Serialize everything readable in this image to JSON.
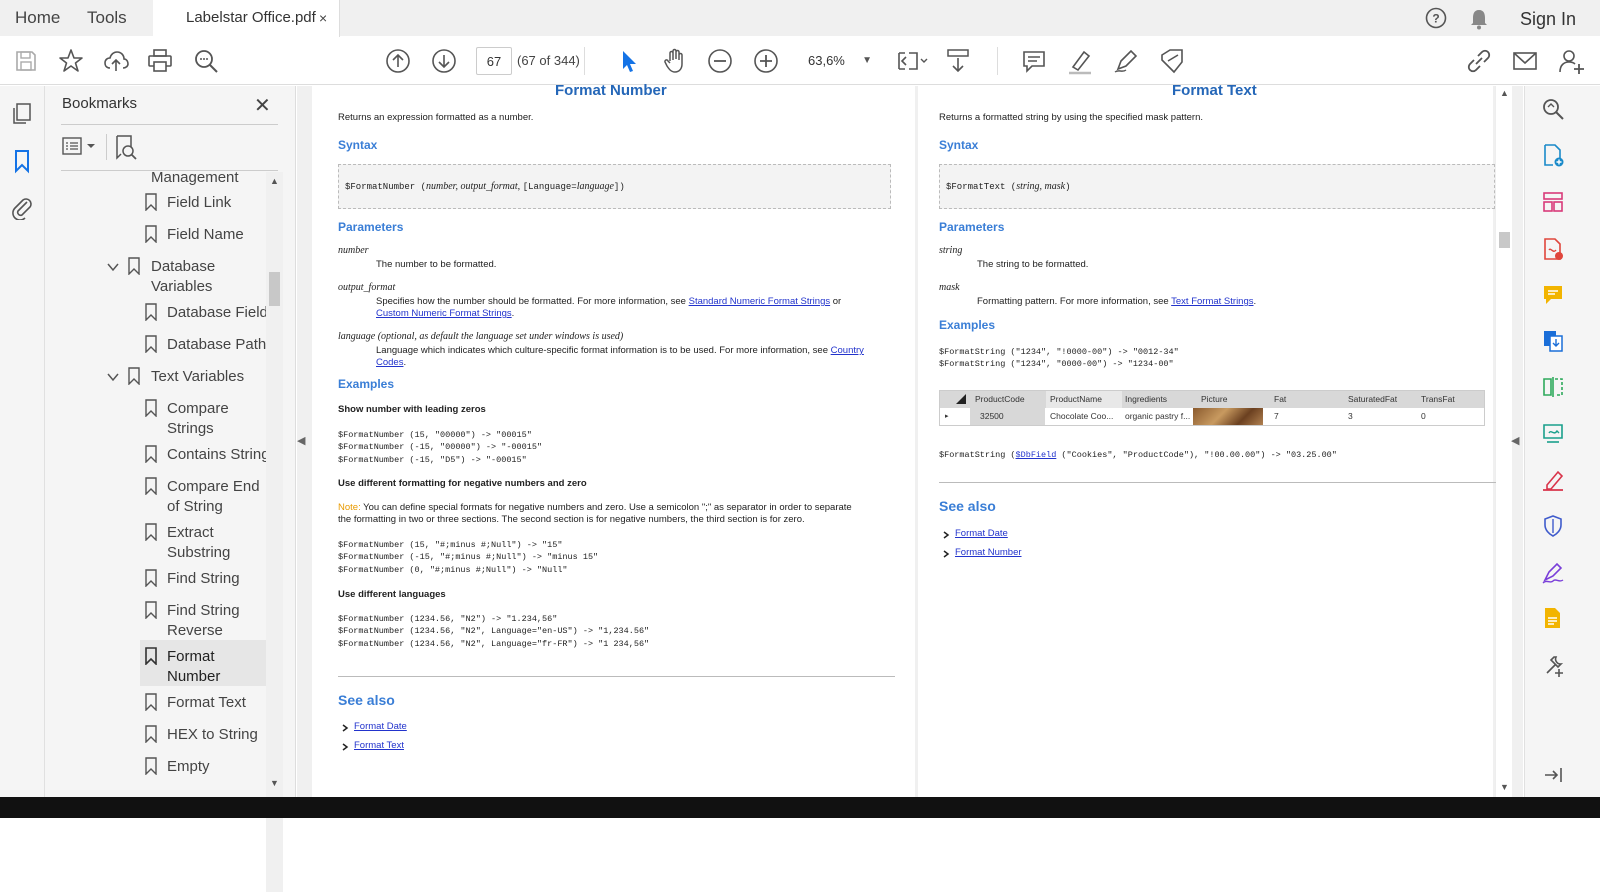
{
  "menubar": {
    "home": "Home",
    "tools": "Tools",
    "tab_title": "Labelstar Office.pdf",
    "tab_close": "×",
    "sign_in": "Sign In"
  },
  "toolbar": {
    "page_input": "67",
    "page_count": "(67 of 344)",
    "zoom": "63,6%"
  },
  "bookmarks": {
    "title": "Bookmarks",
    "close": "✕",
    "items": [
      {
        "label": "Management"
      },
      {
        "label": "Field Link"
      },
      {
        "label": "Field Name"
      },
      {
        "label": "Database"
      },
      {
        "label": "Variables"
      },
      {
        "label": "Database Field"
      },
      {
        "label": "Database Path"
      },
      {
        "label": "Text Variables"
      },
      {
        "label": "Compare"
      },
      {
        "label": "Strings"
      },
      {
        "label": "Contains String"
      },
      {
        "label": "Compare End"
      },
      {
        "label": "of String"
      },
      {
        "label": "Extract"
      },
      {
        "label": "Substring"
      },
      {
        "label": "Find String"
      },
      {
        "label": "Find String"
      },
      {
        "label": "Reverse"
      },
      {
        "label": "Format"
      },
      {
        "label": "Number"
      },
      {
        "label": "Format Text"
      },
      {
        "label": "HEX to String"
      },
      {
        "label": "Empty"
      }
    ]
  },
  "left_page": {
    "title": "Format Number",
    "desc": "Returns an expression formatted as a number.",
    "syntax_h": "Syntax",
    "syntax_code": "$FormatNumber (",
    "syntax_args": "number, output_format, ",
    "syntax_lang": "[Language=",
    "syntax_lang_arg": "language",
    "syntax_end": "])",
    "params_h": "Parameters",
    "p1_name": "number",
    "p1_desc": "The number to be formatted.",
    "p2_name": "output_format",
    "p2_desc": "Specifies how the number should be formatted. For more information, see ",
    "p2_link1": "Standard Numeric Format Strings",
    "p2_or": " or",
    "p2_link2": "Custom Numeric Format Strings",
    "p2_dot": ".",
    "p3_name": "language (optional, as default the language set under windows is used)",
    "p3_desc": "Language which indicates which culture-specific format information is to be used. For more information, see ",
    "p3_link": "Country",
    "p3_link2": "Codes",
    "p3_dot": ".",
    "examples_h": "Examples",
    "ex1_h": "Show number with leading zeros",
    "ex1_code": "$FormatNumber (15, \"00000\") -> \"00015\"\n$FormatNumber (-15, \"00000\") -> \"-00015\"\n$FormatNumber (-15, \"D5\") -> \"-00015\"",
    "ex2_h": "Use different formatting for negative numbers and zero",
    "note_label": "Note:",
    "note_text": " You can define special formats for negative numbers and zero. Use a semicolon \";\" as separator in order to separate",
    "note_text2": "the formatting in two or three sections. The second section is for negative numbers, the third section is for zero.",
    "ex2_code": "$FormatNumber (15, \"#;minus #;Null\") -> \"15\"\n$FormatNumber (-15, \"#;minus #;Null\") -> \"minus 15\"\n$FormatNumber (0, \"#;minus #;Null\") -> \"Null\"",
    "ex3_h": "Use different languages",
    "ex3_code": "$FormatNumber (1234.56, \"N2\") -> \"1.234,56\"\n$FormatNumber (1234.56, \"N2\", Language=\"en-US\") -> \"1,234.56\"\n$FormatNumber (1234.56, \"N2\", Language=\"fr-FR\") -> \"1 234,56\"",
    "see_also_h": "See also",
    "see1": "Format Date",
    "see2": "Format Text"
  },
  "right_page": {
    "title": "Format Text",
    "desc": "Returns a formatted string by using the specified mask pattern.",
    "syntax_h": "Syntax",
    "syntax_code": "$FormatText (",
    "syntax_args": "string, mask",
    "syntax_end": ")",
    "params_h": "Parameters",
    "p1_name": "string",
    "p1_desc": "The string to be formatted.",
    "p2_name": "mask",
    "p2_desc": "Formatting pattern. For more information, see ",
    "p2_link": "Text Format Strings",
    "p2_dot": ".",
    "examples_h": "Examples",
    "ex_code": "$FormatString (\"1234\", \"!0000-00\") -> \"0012-34\"\n$FormatString (\"1234\", \"0000-00\") -> \"1234-00\"",
    "table_headers": [
      "ProductCode",
      "ProductName",
      "Ingredients",
      "Picture",
      "Fat",
      "SaturatedFat",
      "TransFat"
    ],
    "table_row": [
      "32500",
      "Chocolate Coo...",
      "organic pastry f...",
      "",
      "7",
      "3",
      "0"
    ],
    "db_code_pre": "$FormatString (",
    "db_code_link": "$DbField",
    "db_code_post": " (\"Cookies\", \"ProductCode\"), \"!00.00.00\") -> \"03.25.00\"",
    "see_also_h": "See also",
    "see1": "Format Date",
    "see2": "Format Number"
  },
  "colors": {
    "accent": "#1473e6",
    "heading": "#2567b8",
    "link": "#2233cc",
    "note": "#e89a00"
  }
}
